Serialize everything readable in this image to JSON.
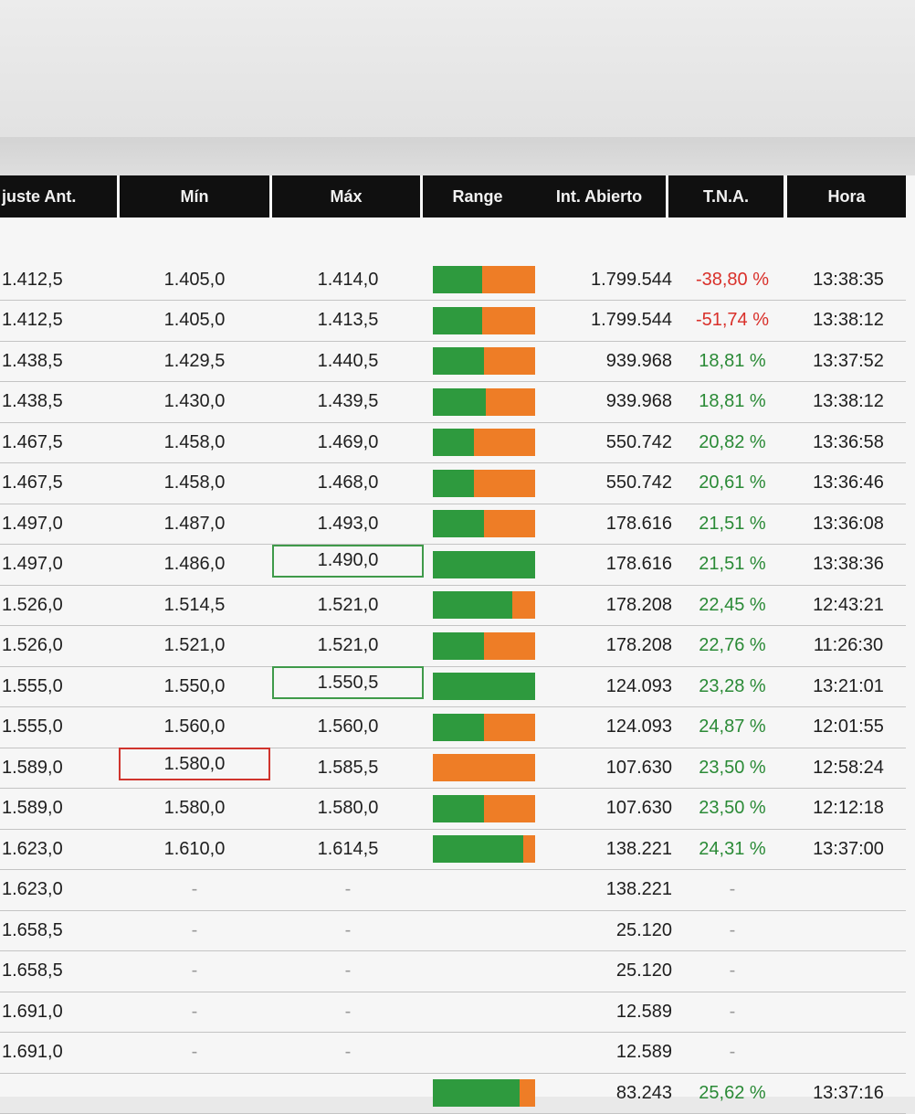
{
  "table": {
    "columns": {
      "ajuste": "juste Ant.",
      "min": "Mín",
      "max": "Máx",
      "range": "Range",
      "int_abierto": "Int. Abierto",
      "tna": "T.N.A.",
      "hora": "Hora"
    },
    "rows": [
      {
        "ajuste": "1.412,5",
        "min": "1.405,0",
        "max": "1.414,0",
        "range_green": 0.48,
        "int_abierto": "1.799.544",
        "tna": "-38,80 %",
        "tna_sign": "neg",
        "hora": "13:38:35"
      },
      {
        "ajuste": "1.412,5",
        "min": "1.405,0",
        "max": "1.413,5",
        "range_green": 0.48,
        "int_abierto": "1.799.544",
        "tna": "-51,74 %",
        "tna_sign": "neg",
        "hora": "13:38:12"
      },
      {
        "ajuste": "1.438,5",
        "min": "1.429,5",
        "max": "1.440,5",
        "range_green": 0.5,
        "int_abierto": "939.968",
        "tna": "18,81 %",
        "tna_sign": "pos",
        "hora": "13:37:52"
      },
      {
        "ajuste": "1.438,5",
        "min": "1.430,0",
        "max": "1.439,5",
        "range_green": 0.52,
        "int_abierto": "939.968",
        "tna": "18,81 %",
        "tna_sign": "pos",
        "hora": "13:38:12"
      },
      {
        "ajuste": "1.467,5",
        "min": "1.458,0",
        "max": "1.469,0",
        "range_green": 0.4,
        "int_abierto": "550.742",
        "tna": "20,82 %",
        "tna_sign": "pos",
        "hora": "13:36:58"
      },
      {
        "ajuste": "1.467,5",
        "min": "1.458,0",
        "max": "1.468,0",
        "range_green": 0.4,
        "int_abierto": "550.742",
        "tna": "20,61 %",
        "tna_sign": "pos",
        "hora": "13:36:46"
      },
      {
        "ajuste": "1.497,0",
        "min": "1.487,0",
        "max": "1.493,0",
        "range_green": 0.5,
        "int_abierto": "178.616",
        "tna": "21,51 %",
        "tna_sign": "pos",
        "hora": "13:36:08"
      },
      {
        "ajuste": "1.497,0",
        "min": "1.486,0",
        "max": "1.490,0",
        "max_box": "green",
        "range_green": 1.0,
        "int_abierto": "178.616",
        "tna": "21,51 %",
        "tna_sign": "pos",
        "hora": "13:38:36"
      },
      {
        "ajuste": "1.526,0",
        "min": "1.514,5",
        "max": "1.521,0",
        "range_green": 0.78,
        "int_abierto": "178.208",
        "tna": "22,45 %",
        "tna_sign": "pos",
        "hora": "12:43:21"
      },
      {
        "ajuste": "1.526,0",
        "min": "1.521,0",
        "max": "1.521,0",
        "range_green": 0.5,
        "int_abierto": "178.208",
        "tna": "22,76 %",
        "tna_sign": "pos",
        "hora": "11:26:30"
      },
      {
        "ajuste": "1.555,0",
        "min": "1.550,0",
        "max": "1.550,5",
        "max_box": "green",
        "range_green": 1.0,
        "int_abierto": "124.093",
        "tna": "23,28 %",
        "tna_sign": "pos",
        "hora": "13:21:01"
      },
      {
        "ajuste": "1.555,0",
        "min": "1.560,0",
        "max": "1.560,0",
        "range_green": 0.5,
        "int_abierto": "124.093",
        "tna": "24,87 %",
        "tna_sign": "pos",
        "hora": "12:01:55"
      },
      {
        "ajuste": "1.589,0",
        "min": "1.580,0",
        "min_box": "red",
        "max": "1.585,5",
        "range_green": 0.0,
        "int_abierto": "107.630",
        "tna": "23,50 %",
        "tna_sign": "pos",
        "hora": "12:58:24"
      },
      {
        "ajuste": "1.589,0",
        "min": "1.580,0",
        "max": "1.580,0",
        "range_green": 0.5,
        "int_abierto": "107.630",
        "tna": "23,50 %",
        "tna_sign": "pos",
        "hora": "12:12:18"
      },
      {
        "ajuste": "1.623,0",
        "min": "1.610,0",
        "max": "1.614,5",
        "range_green": 0.88,
        "int_abierto": "138.221",
        "tna": "24,31 %",
        "tna_sign": "pos",
        "hora": "13:37:00"
      },
      {
        "ajuste": "1.623,0",
        "min": "-",
        "max": "-",
        "range_green": null,
        "int_abierto": "138.221",
        "tna": "-",
        "tna_sign": "none",
        "hora": ""
      },
      {
        "ajuste": "1.658,5",
        "min": "-",
        "max": "-",
        "range_green": null,
        "int_abierto": "25.120",
        "tna": "-",
        "tna_sign": "none",
        "hora": ""
      },
      {
        "ajuste": "1.658,5",
        "min": "-",
        "max": "-",
        "range_green": null,
        "int_abierto": "25.120",
        "tna": "-",
        "tna_sign": "none",
        "hora": ""
      },
      {
        "ajuste": "1.691,0",
        "min": "-",
        "max": "-",
        "range_green": null,
        "int_abierto": "12.589",
        "tna": "-",
        "tna_sign": "none",
        "hora": ""
      },
      {
        "ajuste": "1.691,0",
        "min": "-",
        "max": "-",
        "range_green": null,
        "int_abierto": "12.589",
        "tna": "-",
        "tna_sign": "none",
        "hora": ""
      },
      {
        "ajuste": "",
        "min": "",
        "max": "",
        "range_green": 0.85,
        "int_abierto": "83.243",
        "tna": "25,62 %",
        "tna_sign": "pos",
        "hora": "13:37:16"
      }
    ]
  }
}
